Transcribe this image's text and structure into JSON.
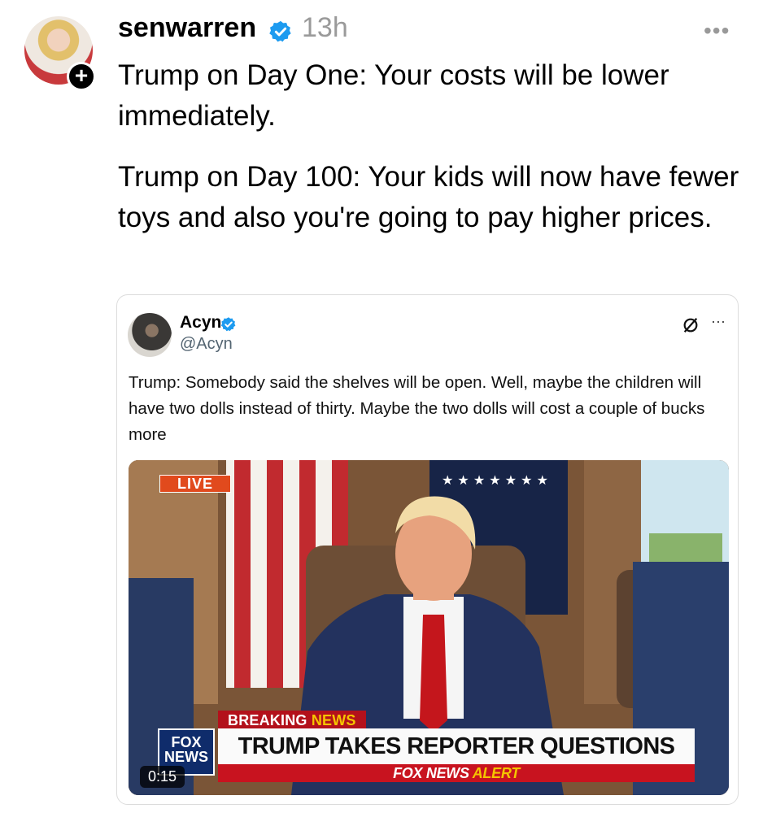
{
  "post": {
    "username": "senwarren",
    "timestamp": "13h",
    "more_icon": "•••",
    "follow_icon": "+",
    "paragraphs": [
      "Trump on Day One: Your costs will be lower immediately.",
      "Trump on Day 100: Your kids will now have fewer toys and also you're going to pay higher prices."
    ]
  },
  "quote": {
    "name": "Acyn",
    "handle": "@Acyn",
    "more_icon": "···",
    "text": "Trump: Somebody said the shelves will be open. Well, maybe the children will have two dolls instead of thirty. Maybe the two dolls will cost a couple of bucks more",
    "media": {
      "live_label": "LIVE",
      "breaking_label": "BREAKING",
      "breaking_news": "NEWS",
      "headline": "TRUMP TAKES REPORTER QUESTIONS",
      "alert_prefix": "FOX NEWS",
      "alert_suffix": "ALERT",
      "logo_line1": "FOX",
      "logo_line2": "NEWS",
      "duration": "0:15"
    }
  },
  "colors": {
    "verified": "#1d9bf0",
    "fox_red": "#c8131f",
    "fox_yellow": "#f5c400"
  }
}
